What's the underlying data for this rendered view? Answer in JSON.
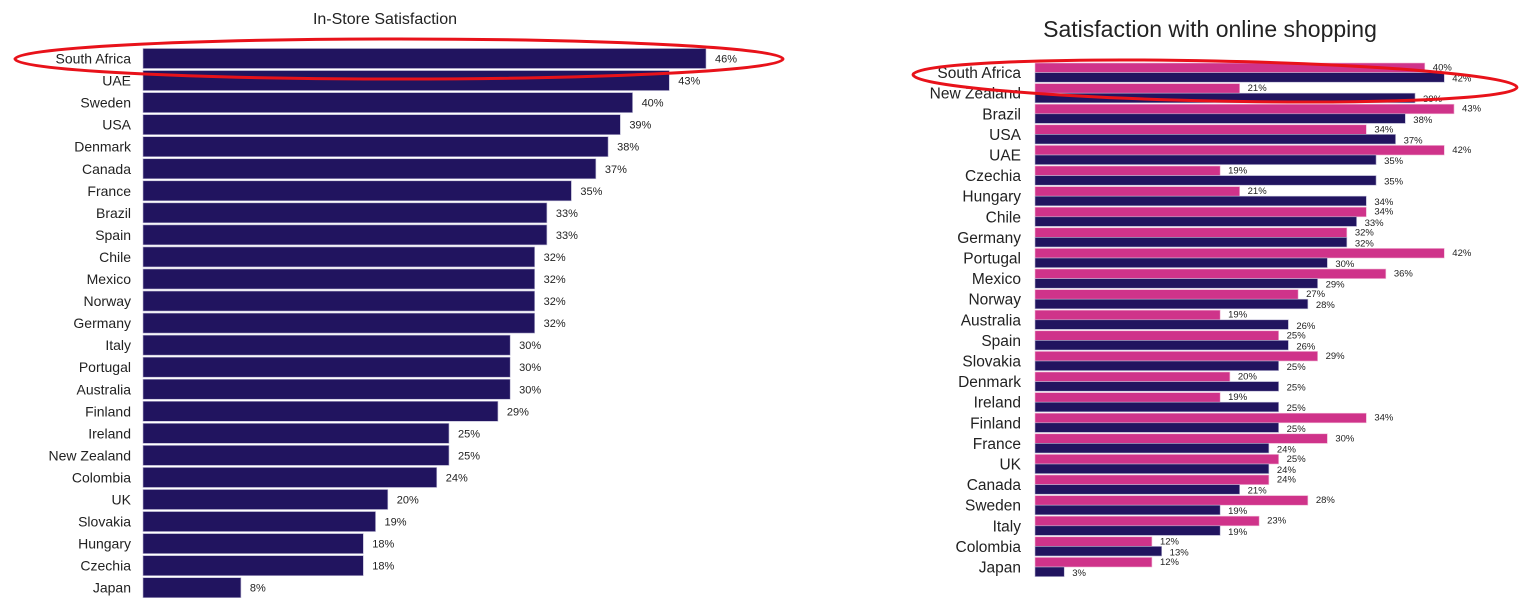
{
  "colors": {
    "in_store": "#21145f",
    "online_pink": "#cf338a",
    "online_blue": "#21145f",
    "highlight": "#e8121a"
  },
  "chart_data": [
    {
      "type": "bar",
      "orientation": "horizontal",
      "title": "In-Store Satisfaction",
      "xlabel": "",
      "ylabel": "",
      "value_suffix": "%",
      "xlim": [
        0,
        50
      ],
      "grid": false,
      "legend": "none",
      "highlighted_category": "South Africa",
      "categories": [
        "South Africa",
        "UAE",
        "Sweden",
        "USA",
        "Denmark",
        "Canada",
        "France",
        "Brazil",
        "Spain",
        "Chile",
        "Mexico",
        "Norway",
        "Germany",
        "Italy",
        "Portugal",
        "Australia",
        "Finland",
        "Ireland",
        "New Zealand",
        "Colombia",
        "UK",
        "Slovakia",
        "Hungary",
        "Czechia",
        "Japan"
      ],
      "values": [
        46,
        43,
        40,
        39,
        38,
        37,
        35,
        33,
        33,
        32,
        32,
        32,
        32,
        30,
        30,
        30,
        29,
        25,
        25,
        24,
        20,
        19,
        18,
        18,
        8
      ]
    },
    {
      "type": "bar",
      "orientation": "horizontal",
      "title": "Satisfaction with online shopping",
      "xlabel": "",
      "ylabel": "",
      "value_suffix": "%",
      "xlim": [
        0,
        50
      ],
      "grid": false,
      "legend": "none",
      "highlighted_category": "South Africa",
      "categories": [
        "South Africa",
        "New Zealand",
        "Brazil",
        "USA",
        "UAE",
        "Czechia",
        "Hungary",
        "Chile",
        "Germany",
        "Portugal",
        "Mexico",
        "Norway",
        "Australia",
        "Spain",
        "Slovakia",
        "Denmark",
        "Ireland",
        "Finland",
        "France",
        "UK",
        "Canada",
        "Sweden",
        "Italy",
        "Colombia",
        "Japan"
      ],
      "series": [
        {
          "name": "pink series",
          "color_key": "online_pink",
          "values": [
            40,
            21,
            43,
            34,
            42,
            19,
            21,
            34,
            32,
            42,
            36,
            27,
            19,
            25,
            29,
            20,
            19,
            34,
            30,
            25,
            24,
            28,
            23,
            12,
            12
          ]
        },
        {
          "name": "navy series",
          "color_key": "online_blue",
          "values": [
            42,
            39,
            38,
            37,
            35,
            35,
            34,
            33,
            32,
            30,
            29,
            28,
            26,
            26,
            25,
            25,
            25,
            25,
            24,
            24,
            21,
            19,
            19,
            13,
            3
          ]
        }
      ]
    }
  ]
}
